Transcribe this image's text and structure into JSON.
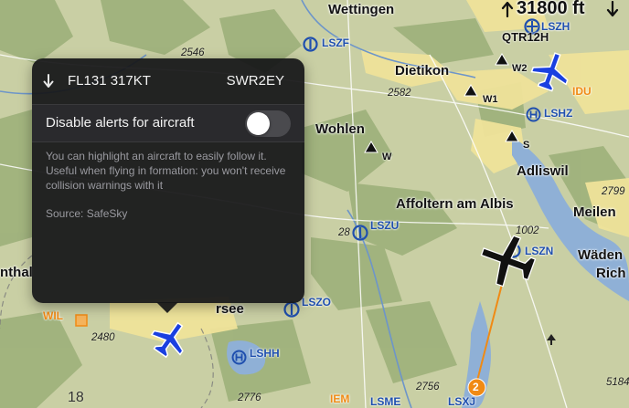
{
  "altitude_readout": "31800 ft",
  "popover": {
    "flight_info": "FL131 317KT",
    "callsign": "SWR2EY",
    "toggle_label": "Disable alerts for aircraft",
    "toggle_on": false,
    "description": "You can highlight an aircraft to easily follow it. Useful when flying in formation: you won't receive collision warnings with it",
    "source": "Source: SafeSky"
  },
  "map": {
    "towns": [
      "Wettingen",
      "Dietikon",
      "Wohlen",
      "Adliswil",
      "Affoltern am Albis",
      "Meilen",
      "Wäden",
      "Rich",
      "nthal",
      "rsee"
    ],
    "airports": [
      "LSZF",
      "LSZH",
      "LSHZ",
      "LSZU",
      "LSZN",
      "LSZO",
      "LSHH",
      "LSME",
      "LSXJ"
    ],
    "orange_labels": [
      "IDU",
      "WIL",
      "IEM",
      "QTR12H"
    ],
    "waypoints": [
      "W1",
      "W2",
      "W",
      "S"
    ],
    "elevations": [
      "2546",
      "2582",
      "2799",
      "5184",
      "2480",
      "2756",
      "2776",
      "1002",
      "28",
      "18"
    ],
    "traffic_badge": "2",
    "colors": {
      "aircraft_blue": "#1a40e0",
      "selected_aircraft": "#111111",
      "track_line": "#f08a14",
      "airport_blue": "#1f4fae",
      "lake": "#8fb0d6"
    }
  }
}
